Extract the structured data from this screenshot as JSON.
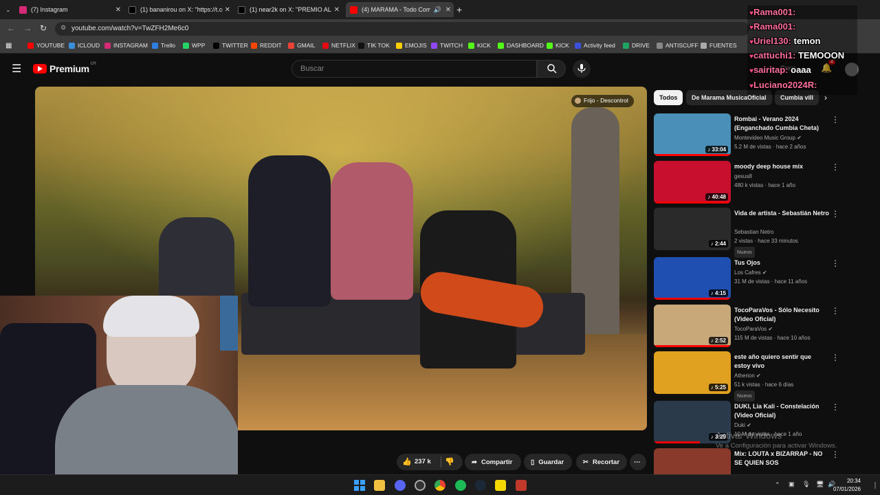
{
  "tabs": [
    {
      "title": "(7) Instagram",
      "color": "#d62976"
    },
    {
      "title": "(1) bananirou on X: \"https://t.co",
      "color": "#ffffff"
    },
    {
      "title": "(1) near2k on X: \"PREMIO AL G",
      "color": "#ffffff"
    },
    {
      "title": "(4) MARAMA - Todo Come",
      "color": "#ff0000"
    }
  ],
  "url": "youtube.com/watch?v=TwZFH2Me6c0",
  "bookmarks": [
    "YOUTUBE",
    "ICLOUD",
    "INSTAGRAM",
    "Trello",
    "WPP",
    "TWITTER",
    "REDDIT",
    "GMAIL",
    "NETFLIX",
    "TIK TOK",
    "EMOJIS",
    "TWITCH",
    "KICK",
    "DASHBOARD",
    "KICK",
    "Activity feed",
    "DRIVE",
    "ANTISCUFF",
    "FUENTES"
  ],
  "header": {
    "logo_text": "Premium",
    "logo_sup": "UY",
    "search_placeholder": "Buscar",
    "create_label": "Crear",
    "notif_count": "4"
  },
  "video": {
    "channel_chip": "Frijo - Descontrol"
  },
  "chips": [
    "Todos",
    "De Marama MusicaOficial",
    "Cumbia vill"
  ],
  "recommendations": [
    {
      "title": "Rombai - Verano 2024 (Enganchado Cumbia Cheta)",
      "channel": "Montevideo Music Group",
      "verified": true,
      "stats": "5.2 M de vistas · hace 2 años",
      "duration": "33:04",
      "badge": "",
      "progress": 1.0,
      "thumb": "#4a8fb8"
    },
    {
      "title": "moody deep house mix",
      "channel": "gesus8",
      "verified": false,
      "stats": "480 k vistas · hace 1 año",
      "duration": "40:48",
      "badge": "",
      "progress": 1.0,
      "thumb": "#c8102e"
    },
    {
      "title": "Vida de artista - Sebastián Netro",
      "channel": "Sebastian Netro",
      "verified": false,
      "stats": "2 vistas · hace 33 minutos",
      "duration": "2:44",
      "badge": "Nuevo",
      "progress": 0,
      "thumb": "#2a2a2a"
    },
    {
      "title": "Tus Ojos",
      "channel": "Los Cafres",
      "verified": true,
      "stats": "31 M de vistas · hace 11 años",
      "duration": "4:15",
      "badge": "",
      "progress": 1.0,
      "thumb": "#1f4fb0"
    },
    {
      "title": "TocoParaVos - Sólo Necesito (Video Oficial)",
      "channel": "TocoParaVos",
      "verified": true,
      "stats": "115 M de vistas · hace 10 años",
      "duration": "2:52",
      "badge": "",
      "progress": 1.0,
      "thumb": "#c8a878"
    },
    {
      "title": "este año quiero sentir que estoy vivo",
      "channel": "Atherion",
      "verified": true,
      "stats": "51 k vistas · hace 6 días",
      "duration": "5:25",
      "badge": "Nuevo",
      "progress": 0,
      "thumb": "#e0a020"
    },
    {
      "title": "DUKI, Lia Kali - Constelación (Video Oficial)",
      "channel": "Duki",
      "verified": true,
      "stats": "10 M de vistas · hace 1 año",
      "duration": "3:29",
      "badge": "",
      "progress": 0.6,
      "thumb": "#2a3a4a"
    },
    {
      "title": "Mix: LOUTA x BIZARRAP - NO SE QUIEN SOS",
      "channel": "",
      "verified": false,
      "stats": "",
      "duration": "",
      "badge": "",
      "progress": 0,
      "thumb": "#8a3a2a"
    }
  ],
  "actions": {
    "likes": "237 k",
    "share": "Compartir",
    "save": "Guardar",
    "clip": "Recortar"
  },
  "chat": [
    {
      "user": "Rama001:",
      "msg": ""
    },
    {
      "user": "Rama001:",
      "msg": ""
    },
    {
      "user": "Uriel130:",
      "msg": "temon"
    },
    {
      "user": "cattuchi1:",
      "msg": "TEMOOON"
    },
    {
      "user": "sairitap:",
      "msg": "oaaa"
    },
    {
      "user": "Luciano2024R:",
      "msg": ""
    }
  ],
  "watermark": {
    "line1": "Activar Windows",
    "line2": "Ve a Configuración para activar Windows."
  },
  "clock": {
    "time": "20:34",
    "date": "07/01/2026"
  }
}
